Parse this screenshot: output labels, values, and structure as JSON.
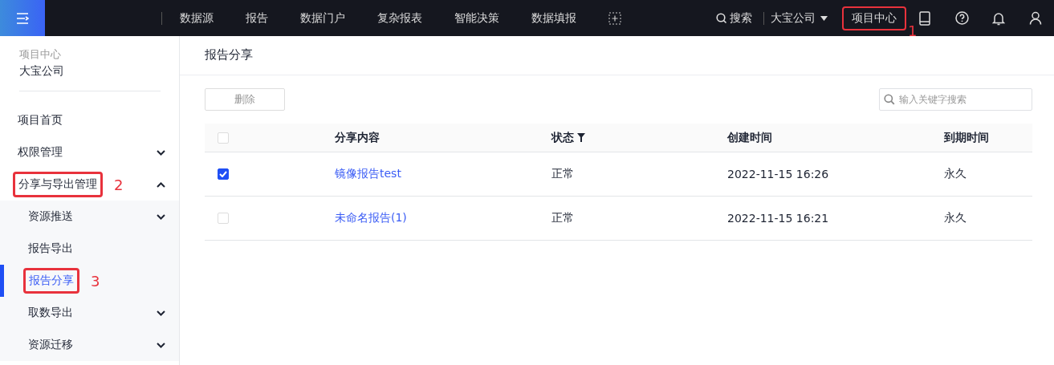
{
  "topbar": {
    "nav": [
      {
        "label": "数据源"
      },
      {
        "label": "报告"
      },
      {
        "label": "数据门户"
      },
      {
        "label": "复杂报表"
      },
      {
        "label": "智能决策"
      },
      {
        "label": "数据填报"
      }
    ],
    "search_label": "搜索",
    "company": "大宝公司",
    "project_center": {
      "label": "项目中心",
      "highlighted": true,
      "callout": "1"
    }
  },
  "sidebar": {
    "caption": "项目中心",
    "company": "大宝公司",
    "items": [
      {
        "label": "项目首页",
        "selected": false,
        "highlighted": false
      },
      {
        "label": "权限管理",
        "selected": false,
        "expanded": false,
        "highlighted": false
      },
      {
        "label": "分享与导出管理",
        "selected": false,
        "expanded": true,
        "highlighted": true,
        "callout": "2",
        "children": [
          {
            "label": "资源推送",
            "selected": false,
            "expanded": false,
            "highlighted": false
          },
          {
            "label": "报告导出",
            "selected": false,
            "highlighted": false
          },
          {
            "label": "报告分享",
            "selected": true,
            "highlighted": true,
            "callout": "3"
          },
          {
            "label": "取数导出",
            "selected": false,
            "expanded": false,
            "highlighted": false
          },
          {
            "label": "资源迁移",
            "selected": false,
            "expanded": false,
            "highlighted": false
          }
        ]
      }
    ]
  },
  "main": {
    "title": "报告分享",
    "delete_button": {
      "label": "删除",
      "disabled": true
    },
    "search": {
      "placeholder": "输入关键字搜索"
    },
    "table": {
      "select_all": {
        "checked": false
      },
      "columns": [
        "分享内容",
        "状态",
        "创建时间",
        "到期时间"
      ],
      "rows": [
        {
          "checked": true,
          "content": "镜像报告test",
          "status": "正常",
          "created": "2022-11-15 16:26",
          "expires": "永久"
        },
        {
          "checked": false,
          "content": "未命名报告(1)",
          "status": "正常",
          "created": "2022-11-15 16:21",
          "expires": "永久"
        }
      ]
    }
  }
}
